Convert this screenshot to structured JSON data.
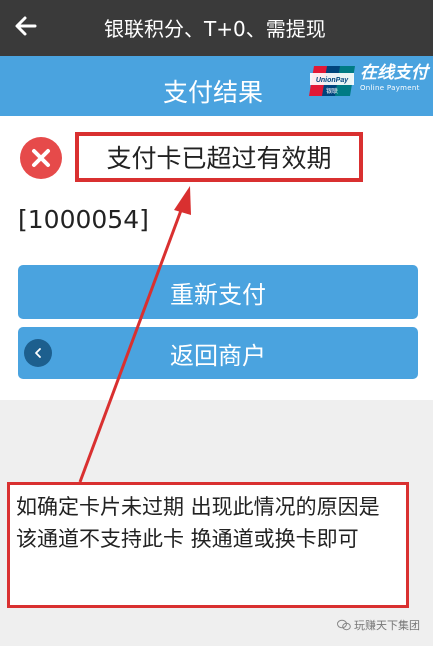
{
  "topbar": {
    "title": "银联积分、T+0、需提现"
  },
  "header": {
    "title": "支付结果",
    "brand_logo_text": "UnionPay 银联",
    "brand_cn": "在线支付",
    "brand_en": "Online Payment"
  },
  "result": {
    "error_message": "支付卡已超过有效期",
    "error_code": "[1000054]"
  },
  "buttons": {
    "repay": "重新支付",
    "back_to_merchant": "返回商户"
  },
  "note": {
    "text": "如确定卡片未过期 出现此情况的原因是该通道不支持此卡 换通道或换卡即可"
  },
  "watermark": {
    "text": "玩赚天下集团"
  },
  "colors": {
    "accent_blue": "#4aa3df",
    "error_red": "#e64a4a",
    "annotation_red": "#d93030",
    "topbar": "#3a3a3a"
  }
}
